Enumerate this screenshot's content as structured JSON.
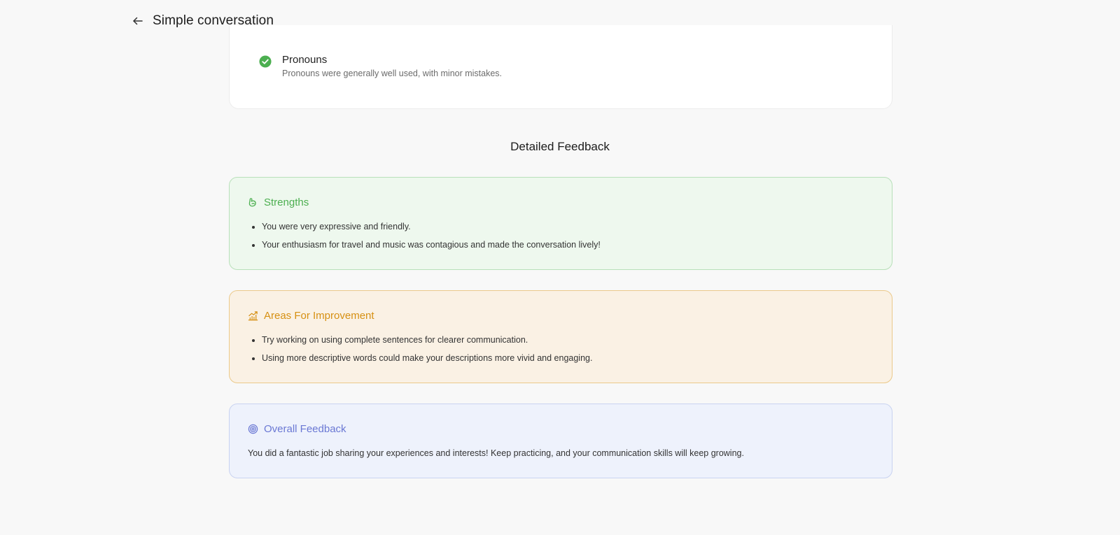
{
  "header": {
    "title": "Simple conversation",
    "back_icon": "arrow-left-icon"
  },
  "criteria": [
    {
      "title": "Pronouns",
      "description": "Pronouns were generally well used, with minor mistakes.",
      "status": "passed",
      "icon": "check-circle-icon",
      "color": "#4caf50"
    }
  ],
  "detailed_feedback": {
    "heading": "Detailed Feedback",
    "strengths": {
      "title": "Strengths",
      "icon": "flexed-arm-icon",
      "color": "#4caf50",
      "items": [
        "You were very expressive and friendly.",
        "Your enthusiasm for travel and music was contagious and made the conversation lively!"
      ]
    },
    "improvement": {
      "title": "Areas For Improvement",
      "icon": "bar-chart-icon",
      "color": "#d69012",
      "items": [
        "Try working on using complete sentences for clearer communication.",
        "Using more descriptive words could make your descriptions more vivid and engaging."
      ]
    },
    "overall": {
      "title": "Overall Feedback",
      "icon": "target-icon",
      "color": "#6a78d4",
      "text": "You did a fantastic job sharing your experiences and interests! Keep practicing, and your communication skills will keep growing."
    }
  }
}
